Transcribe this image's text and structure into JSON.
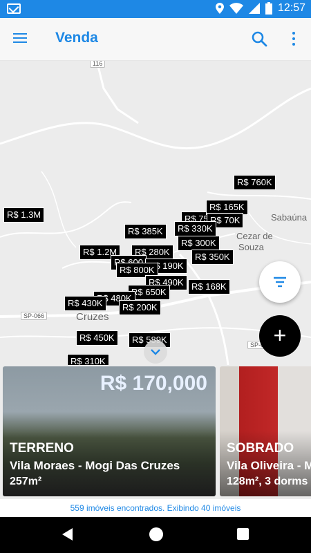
{
  "status_bar": {
    "time": "12:57"
  },
  "app_bar": {
    "title": "Venda"
  },
  "map": {
    "place_labels": [
      "Sabaúna",
      "Cezar de",
      "Souza",
      "Cruzes"
    ],
    "road_tags": [
      "116",
      "SP-066",
      "SP-06"
    ],
    "price_pins": [
      "R$ 760K",
      "R$ 165K",
      "R$ 1.3M",
      "R$ 75",
      "R$ 70K",
      "R$ 385K",
      "R$ 330K",
      "R$ 300K",
      "R$ 1.2M",
      "R$ 350K",
      "R$ 280K",
      "R$ 600",
      "R$ 190K",
      "R$ 800K",
      "R$ 490K",
      "R$ 168K",
      "R$ 650K",
      "R$ 480K",
      "R$ 430K",
      "R$ 200K",
      "R$ 450K",
      "R$ 589K",
      "R$ 310K"
    ]
  },
  "cards": [
    {
      "price": "R$ 170,000",
      "type": "TERRENO",
      "location": "Vila Moraes - Mogi Das Cruzes",
      "area": "257m²"
    },
    {
      "price": "",
      "type": "SOBRADO",
      "location": "Vila Oliveira - M",
      "area": "128m²,  3 dorms"
    }
  ],
  "footer": {
    "summary": "559 imóveis encontrados. Exibindo 40 imóveis"
  },
  "colors": {
    "accent": "#1e88e5",
    "pin_bg": "#000000",
    "map_bg": "#ececec"
  },
  "icons": {
    "menu": "menu-icon",
    "search": "search-icon",
    "more": "more-vert-icon",
    "filter": "filter-icon",
    "add": "plus-icon",
    "collapse": "chevron-down-icon"
  }
}
